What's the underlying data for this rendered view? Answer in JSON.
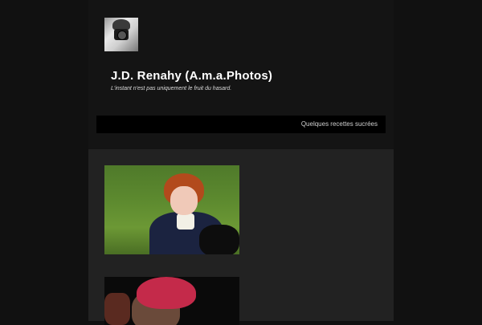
{
  "site": {
    "title": "J.D. Renahy (A.m.a.Photos)",
    "tagline": "L'instant n'est pas uniquement le fruit du hasard."
  },
  "header": {
    "avatar_icon": "camera-photographer-avatar"
  },
  "nav": {
    "items": [
      {
        "label": "Quelques recettes sucrées"
      }
    ]
  },
  "posts": [
    {
      "image": "child-red-hair-portrait"
    },
    {
      "image": "person-red-beret-portrait"
    }
  ]
}
